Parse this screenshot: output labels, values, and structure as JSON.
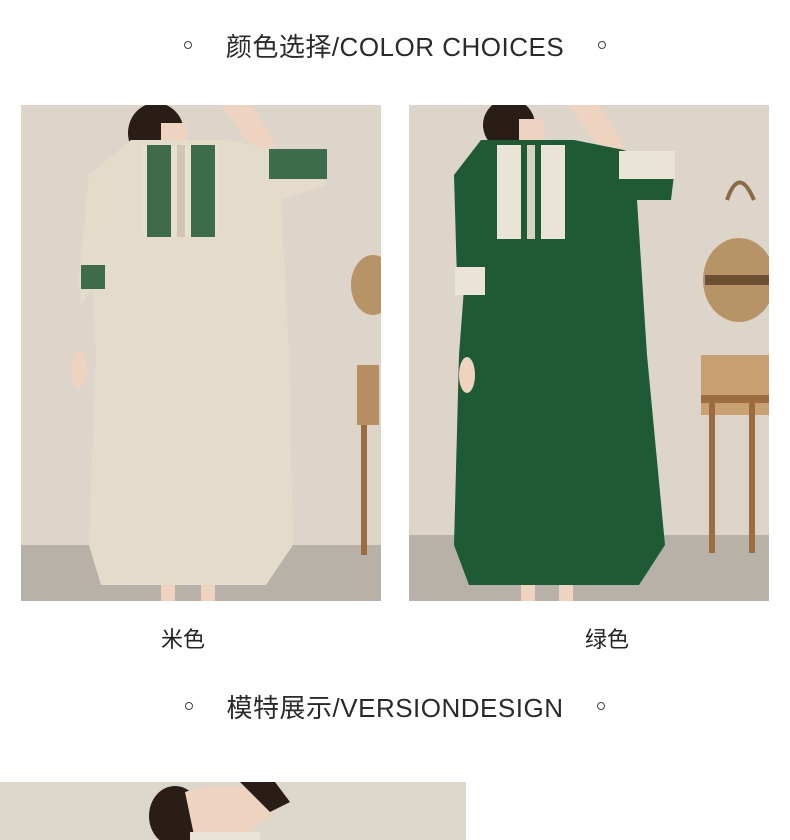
{
  "color_section": {
    "title": "颜色选择/COLOR CHOICES"
  },
  "products": [
    {
      "caption": "米色",
      "color": "#e4dccb"
    },
    {
      "caption": "绿色",
      "color": "#1e5a33"
    }
  ],
  "model_section": {
    "title": "模特展示/VERSIONDESIGN"
  },
  "colors": {
    "wall": "#ddd6cb",
    "floor": "#b9b2aa",
    "beige": "#e4dccb",
    "green": "#1e5a33"
  }
}
